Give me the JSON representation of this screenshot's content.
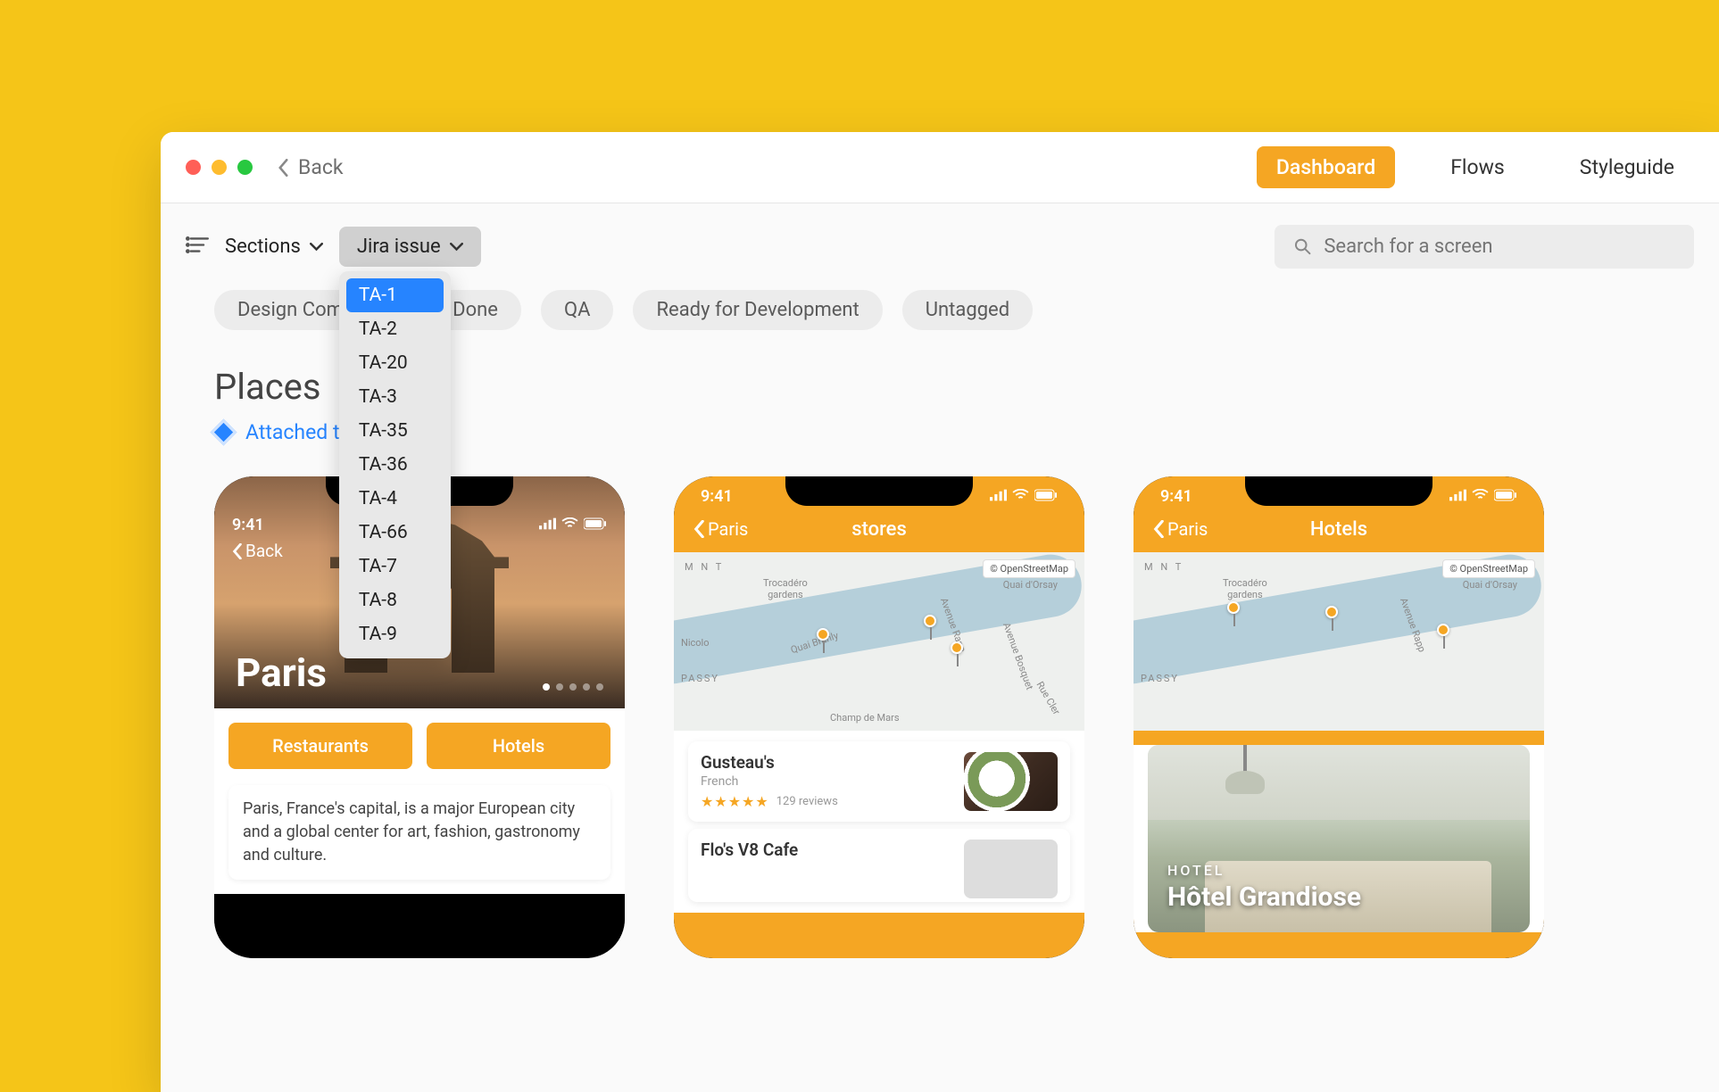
{
  "titlebar": {
    "back": "Back"
  },
  "nav": {
    "dashboard": "Dashboard",
    "flows": "Flows",
    "styleguide": "Styleguide"
  },
  "toolbar": {
    "sections_label": "Sections",
    "jira_label": "Jira issue",
    "search_placeholder": "Search for a screen"
  },
  "jira_dropdown": [
    "TA-1",
    "TA-2",
    "TA-20",
    "TA-3",
    "TA-35",
    "TA-36",
    "TA-4",
    "TA-66",
    "TA-7",
    "TA-8",
    "TA-9"
  ],
  "jira_selected": "TA-1",
  "tags": [
    "Design Complete",
    "Done",
    "QA",
    "Ready for Development",
    "Untagged"
  ],
  "section": {
    "title": "Places",
    "attached_prefix": "Attached to"
  },
  "screens": {
    "paris": {
      "time": "9:41",
      "back": "Back",
      "hero_title": "Paris",
      "btn1": "Restaurants",
      "btn2": "Hotels",
      "description": "Paris, France's capital, is a major European city and a global center for art, fashion, gastronomy and culture."
    },
    "stores": {
      "time": "9:41",
      "back": "Paris",
      "title": "stores",
      "osm": "© OpenStreetMap",
      "map_labels": {
        "mnt": "M N T",
        "trocadero": "Trocadéro\ngardens",
        "nicolo": "Nicolo",
        "passy": "PASSY",
        "quai_branly": "Quai Branly",
        "quai_orsay": "Quai d'Orsay",
        "av_rapp": "Avenue Rapp",
        "av_bosquet": "Avenue Bosquet",
        "champ": "Champ de Mars",
        "rue_cler": "Rue Cler"
      },
      "item1": {
        "name": "Gusteau's",
        "sub": "French",
        "reviews": "129 reviews"
      },
      "item2": {
        "name": "Flo's V8 Cafe"
      }
    },
    "hotels": {
      "time": "9:41",
      "back": "Paris",
      "title": "Hotels",
      "osm": "© OpenStreetMap",
      "kicker": "HOTEL",
      "name": "Hôtel Grandiose"
    }
  }
}
